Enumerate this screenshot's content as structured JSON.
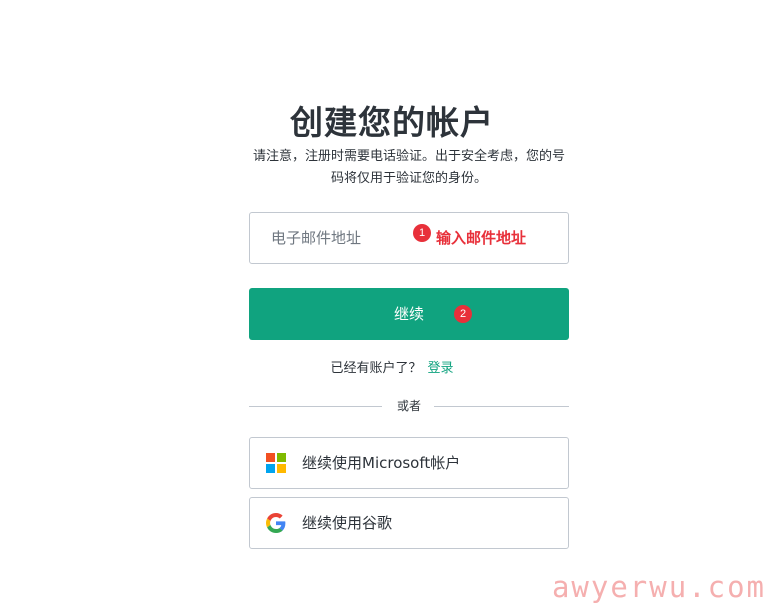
{
  "header": {
    "title": "创建您的帐户",
    "subtitle": "请注意，注册时需要电话验证。出于安全考虑，您的号码将仅用于验证您的身份。"
  },
  "email": {
    "placeholder": "电子邮件地址",
    "value": ""
  },
  "annotations": {
    "step1_number": "1",
    "step1_text": "输入邮件地址",
    "step2_number": "2"
  },
  "continue_button": {
    "label": "继续"
  },
  "login": {
    "prompt": "已经有账户了？",
    "link_label": "登录"
  },
  "divider": {
    "text": "或者"
  },
  "social": {
    "microsoft": {
      "label": "继续使用Microsoft帐户",
      "icon": "microsoft-logo-icon"
    },
    "google": {
      "label": "继续使用谷歌",
      "icon": "google-logo-icon"
    }
  },
  "watermark": {
    "text": "awyerwu.com"
  },
  "colors": {
    "accent": "#10a37f",
    "annotation": "#e8303a",
    "border": "#c2c8d0",
    "text": "#2d333a"
  }
}
